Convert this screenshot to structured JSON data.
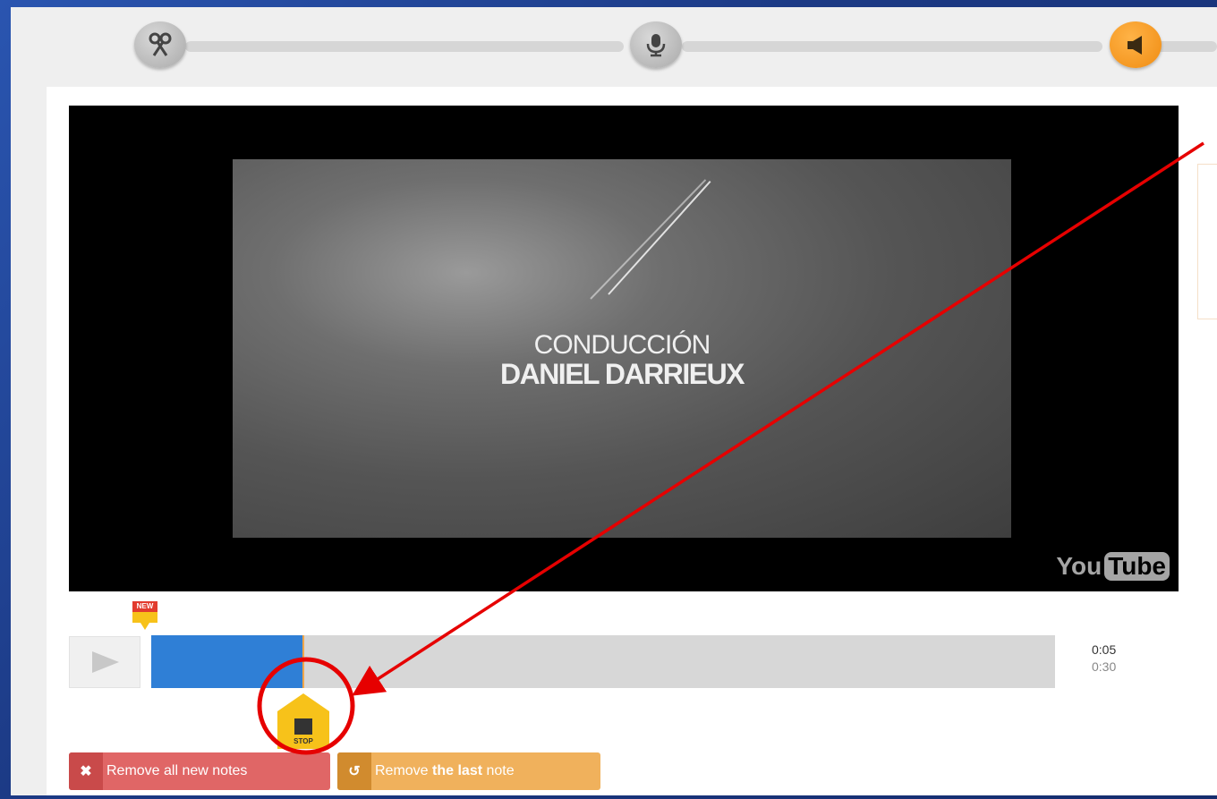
{
  "steps": [
    {
      "name": "cut",
      "icon": "scissors-icon",
      "active": false
    },
    {
      "name": "record",
      "icon": "microphone-icon",
      "active": false
    },
    {
      "name": "listen",
      "icon": "speaker-icon",
      "active": true
    }
  ],
  "video": {
    "caption_line1": "CONDUCCIÓN",
    "caption_line2": "DANIEL DARRIEUX",
    "watermark_you": "You",
    "watermark_tube": "Tube"
  },
  "player": {
    "current_time": "0:05",
    "total_time": "0:30",
    "progress": 0.167,
    "new_marker_label": "NEW",
    "stop_label": "STOP"
  },
  "actions": {
    "remove_all_label": "Remove all new notes",
    "remove_last_prefix": "Remove ",
    "remove_last_bold": "the last",
    "remove_last_suffix": " note"
  },
  "colors": {
    "accent_orange": "#f08c12",
    "progress_blue": "#2f7fd6",
    "danger_red": "#e06666",
    "annotation_red": "#e60000"
  }
}
